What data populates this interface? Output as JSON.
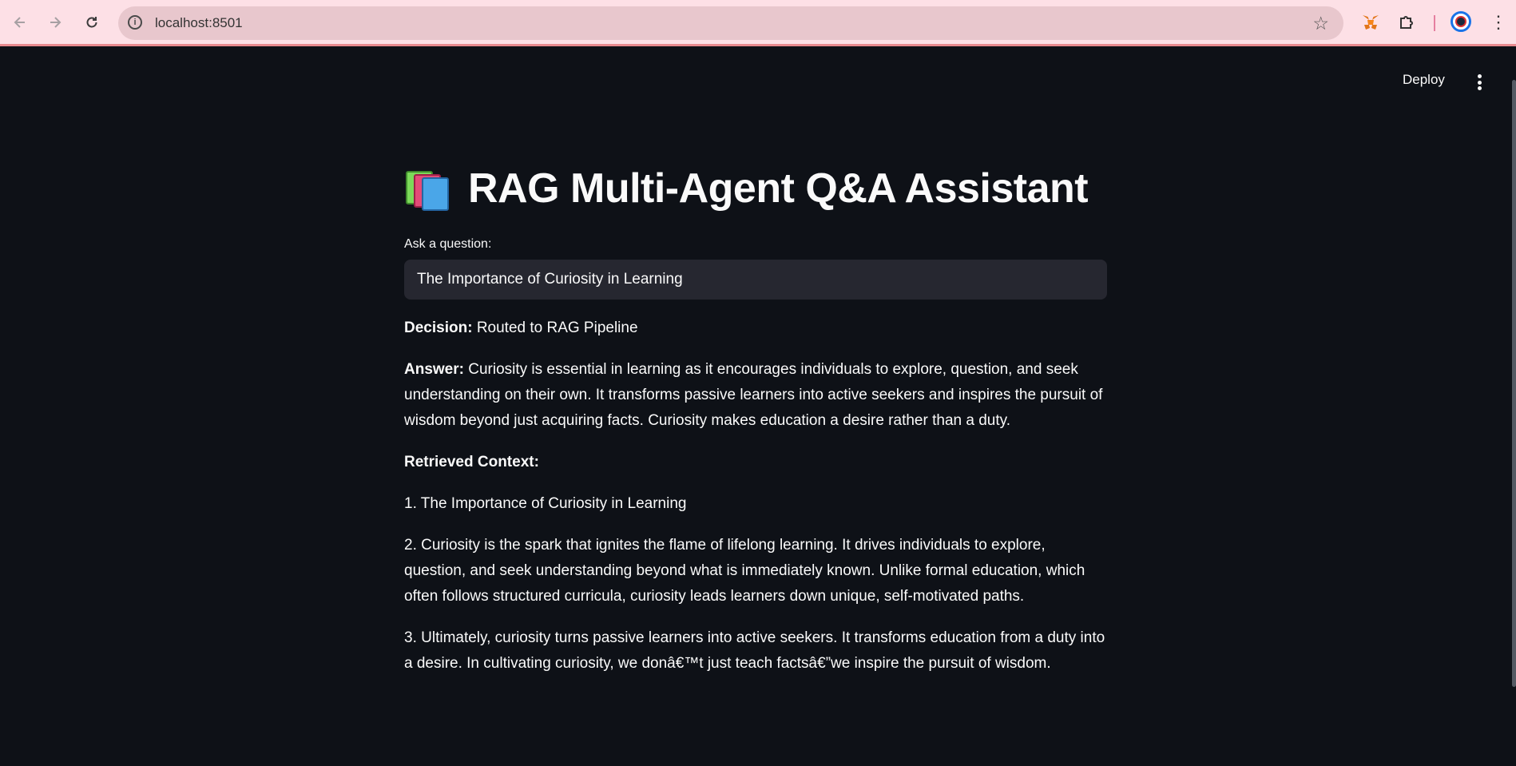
{
  "browser": {
    "url": "localhost:8501",
    "icons": [
      "back-icon",
      "forward-icon",
      "reload-icon",
      "site-info-icon",
      "star-icon",
      "metamask-icon",
      "extensions-icon",
      "profile-icon",
      "menu-icon"
    ]
  },
  "app": {
    "deploy_label": "Deploy",
    "title": "RAG Multi-Agent Q&A Assistant",
    "question_label": "Ask a question:",
    "question_value": "The Importance of Curiosity in Learning",
    "decision_label": "Decision:",
    "decision_value": "Routed to RAG Pipeline",
    "answer_label": "Answer:",
    "answer_value": "Curiosity is essential in learning as it encourages individuals to explore, question, and seek understanding on their own. It transforms passive learners into active seekers and inspires the pursuit of wisdom beyond just acquiring facts. Curiosity makes education a desire rather than a duty.",
    "context_label": "Retrieved Context:",
    "context_items": [
      "1. The Importance of Curiosity in Learning",
      "2. Curiosity is the spark that ignites the flame of lifelong learning. It drives individuals to explore, question, and seek understanding beyond what is immediately known. Unlike formal education, which often follows structured curricula, curiosity leads learners down unique, self-motivated paths.",
      "3. Ultimately, curiosity turns passive learners into active seekers. It transforms education from a duty into a desire. In cultivating curiosity, we donâ€™t just teach factsâ€”we inspire the pursuit of wisdom."
    ]
  },
  "colors": {
    "app_bg": "#0e1117",
    "input_bg": "#262730",
    "text": "#fafafa",
    "chrome_bg": "#fde0e6",
    "omnibox_bg": "#e8c7cd"
  }
}
